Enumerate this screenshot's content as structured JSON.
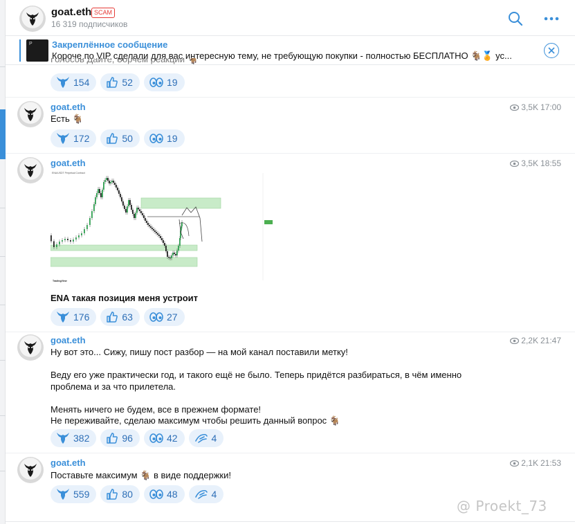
{
  "header": {
    "channel_name": "goat.eth",
    "scam_badge": "SCAM",
    "subscribers": "16 319 подписчиков",
    "search_icon": "search-icon",
    "menu_icon": "more-icon"
  },
  "pinned": {
    "title": "Закреплённое сообщение",
    "text": "Короче по VIP сделали для вас интересную тему, не требующую покупки - полностью БЕСПЛАТНО 🐐🏅 ус...",
    "close_icon": "close-icon"
  },
  "cut_message": {
    "text": "Голосов Дайте, Зорчем реакции 🐐",
    "reactions": [
      {
        "icon": "goat-emoji-icon",
        "count": "154"
      },
      {
        "icon": "thumbs-up-icon",
        "count": "52"
      },
      {
        "icon": "eyes-icon",
        "count": "19"
      }
    ]
  },
  "messages": [
    {
      "sender": "goat.eth",
      "views": "3,5K",
      "time": "17:00",
      "lines": [
        "Есть 🐐"
      ],
      "reactions": [
        {
          "icon": "goat-emoji-icon",
          "count": "172"
        },
        {
          "icon": "thumbs-up-icon",
          "count": "50"
        },
        {
          "icon": "eyes-icon",
          "count": "19"
        }
      ]
    },
    {
      "sender": "goat.eth",
      "views": "3,5K",
      "time": "18:55",
      "lines": [
        "ENA такая позиция меня устроит"
      ],
      "reactions": [
        {
          "icon": "goat-emoji-icon",
          "count": "176"
        },
        {
          "icon": "thumbs-up-icon",
          "count": "63"
        },
        {
          "icon": "eyes-icon",
          "count": "27"
        }
      ]
    },
    {
      "sender": "goat.eth",
      "views": "2,2K",
      "time": "21:47",
      "lines": [
        "Ну вот это... Сижу, пишу пост разбор — на мой канал поставили метку!",
        "",
        "Веду его уже практически год, и такого ещё не было. Теперь придётся разбираться, в чём именно",
        "проблема и за что прилетела.",
        "",
        "Менять ничего не будем, все в прежнем формате!",
        "Не переживайте, сделаю максимум чтобы решить данный вопрос 🐐"
      ],
      "reactions": [
        {
          "icon": "goat-emoji-icon",
          "count": "382"
        },
        {
          "icon": "thumbs-up-icon",
          "count": "96"
        },
        {
          "icon": "eyes-icon",
          "count": "42"
        },
        {
          "icon": "hand-icon",
          "count": "4"
        }
      ]
    },
    {
      "sender": "goat.eth",
      "views": "2,1K",
      "time": "21:53",
      "lines": [
        "Поставьте максимум 🐐 в виде поддержки!"
      ],
      "reactions": [
        {
          "icon": "goat-emoji-icon",
          "count": "559"
        },
        {
          "icon": "thumbs-up-icon",
          "count": "80"
        },
        {
          "icon": "eyes-icon",
          "count": "48"
        },
        {
          "icon": "hand-icon",
          "count": "4"
        }
      ]
    }
  ],
  "chart_image": {
    "header_text": "ENA/USDT Perpetual Contract",
    "footer_text": "TradingView"
  },
  "watermark": "@ Proekt_73",
  "colors": {
    "accent": "#3a8fd9",
    "scam": "#e53935",
    "reaction_bg": "#e8f1fb",
    "zone_green": "#c8ebc8"
  }
}
